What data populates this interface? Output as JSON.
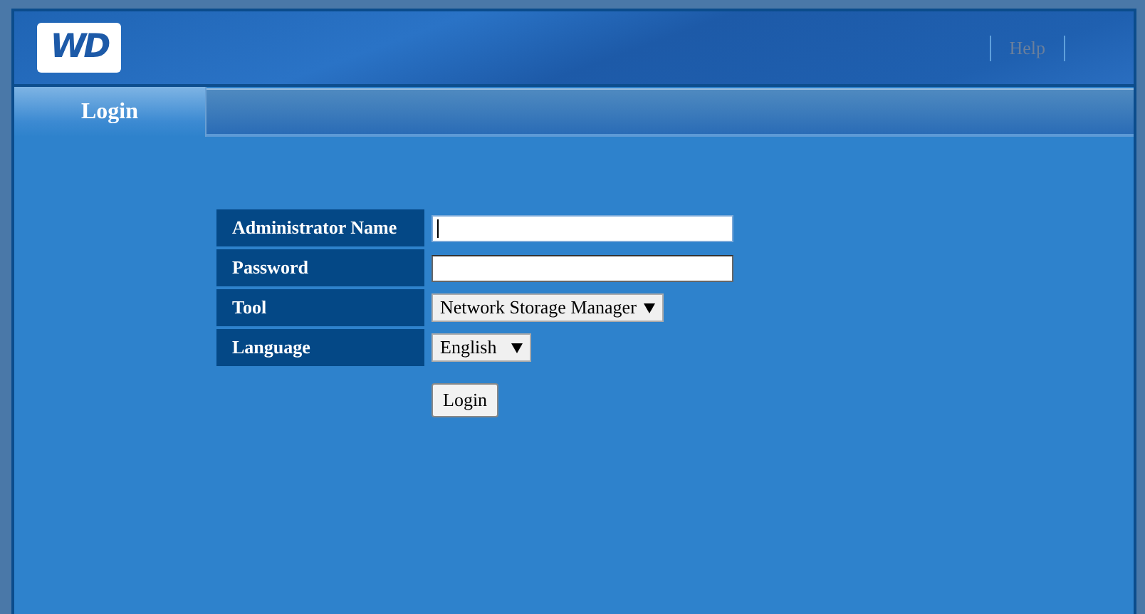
{
  "header": {
    "logo": "WD",
    "links": [
      "Help"
    ]
  },
  "tabs": [
    {
      "label": "Login",
      "selected": true
    }
  ],
  "form": {
    "fields": [
      {
        "label": "Administrator Name",
        "kind": "text",
        "focused": true
      },
      {
        "label": "Password",
        "kind": "password",
        "focused": false
      },
      {
        "label": "Tool",
        "kind": "select",
        "value": "Network Storage Manager"
      },
      {
        "label": "Language",
        "kind": "select",
        "value": "English"
      }
    ],
    "submit": "Login"
  }
}
